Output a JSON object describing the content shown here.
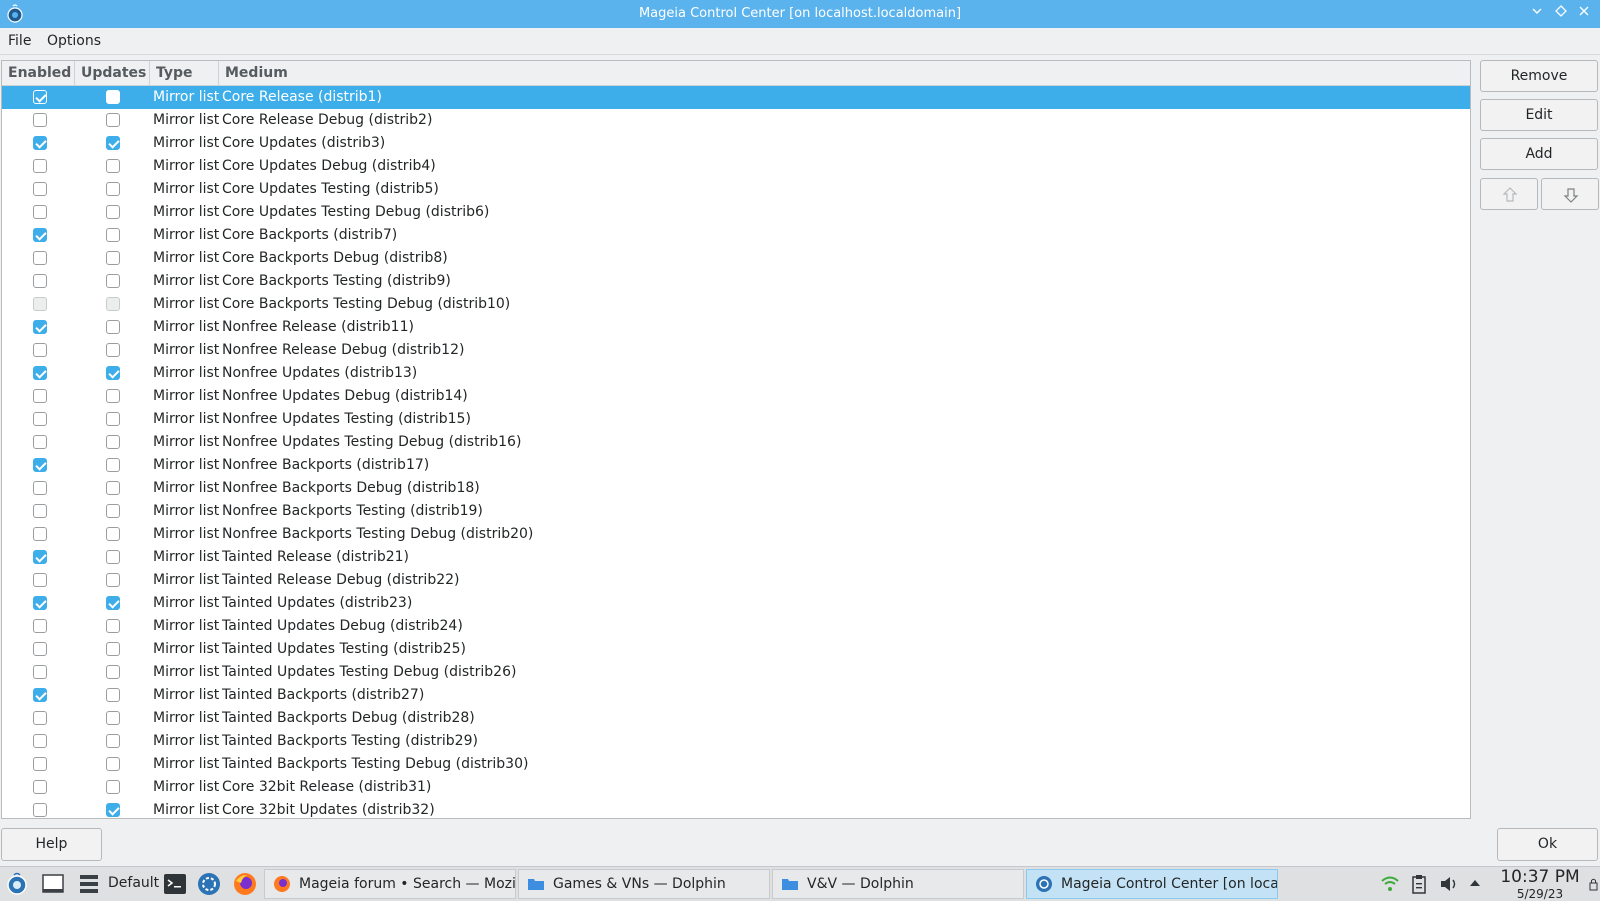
{
  "window": {
    "title": "Mageia Control Center [on localhost.localdomain]",
    "controls": [
      "minimize-icon",
      "maximize-icon",
      "close-icon"
    ]
  },
  "menu": {
    "file": "File",
    "options": "Options"
  },
  "table": {
    "headers": {
      "enabled": "Enabled",
      "updates": "Updates",
      "type": "Type",
      "medium": "Medium"
    },
    "rows": [
      {
        "enabled": true,
        "updates": false,
        "type": "Mirror list",
        "medium": "Core Release (distrib1)",
        "selected": true
      },
      {
        "enabled": false,
        "updates": false,
        "type": "Mirror list",
        "medium": "Core Release Debug (distrib2)"
      },
      {
        "enabled": true,
        "updates": true,
        "type": "Mirror list",
        "medium": "Core Updates (distrib3)"
      },
      {
        "enabled": false,
        "updates": false,
        "type": "Mirror list",
        "medium": "Core Updates Debug (distrib4)"
      },
      {
        "enabled": false,
        "updates": false,
        "type": "Mirror list",
        "medium": "Core Updates Testing (distrib5)"
      },
      {
        "enabled": false,
        "updates": false,
        "type": "Mirror list",
        "medium": "Core Updates Testing Debug (distrib6)"
      },
      {
        "enabled": true,
        "updates": false,
        "type": "Mirror list",
        "medium": "Core Backports (distrib7)"
      },
      {
        "enabled": false,
        "updates": false,
        "type": "Mirror list",
        "medium": "Core Backports Debug (distrib8)"
      },
      {
        "enabled": false,
        "updates": false,
        "type": "Mirror list",
        "medium": "Core Backports Testing (distrib9)"
      },
      {
        "enabled": false,
        "updates": false,
        "type": "Mirror list",
        "medium": "Core Backports Testing Debug (distrib10)",
        "disabled": true
      },
      {
        "enabled": true,
        "updates": false,
        "type": "Mirror list",
        "medium": "Nonfree Release (distrib11)"
      },
      {
        "enabled": false,
        "updates": false,
        "type": "Mirror list",
        "medium": "Nonfree Release Debug (distrib12)"
      },
      {
        "enabled": true,
        "updates": true,
        "type": "Mirror list",
        "medium": "Nonfree Updates (distrib13)"
      },
      {
        "enabled": false,
        "updates": false,
        "type": "Mirror list",
        "medium": "Nonfree Updates Debug (distrib14)"
      },
      {
        "enabled": false,
        "updates": false,
        "type": "Mirror list",
        "medium": "Nonfree Updates Testing (distrib15)"
      },
      {
        "enabled": false,
        "updates": false,
        "type": "Mirror list",
        "medium": "Nonfree Updates Testing Debug (distrib16)"
      },
      {
        "enabled": true,
        "updates": false,
        "type": "Mirror list",
        "medium": "Nonfree Backports (distrib17)"
      },
      {
        "enabled": false,
        "updates": false,
        "type": "Mirror list",
        "medium": "Nonfree Backports Debug (distrib18)"
      },
      {
        "enabled": false,
        "updates": false,
        "type": "Mirror list",
        "medium": "Nonfree Backports Testing (distrib19)"
      },
      {
        "enabled": false,
        "updates": false,
        "type": "Mirror list",
        "medium": "Nonfree Backports Testing Debug (distrib20)"
      },
      {
        "enabled": true,
        "updates": false,
        "type": "Mirror list",
        "medium": "Tainted Release (distrib21)"
      },
      {
        "enabled": false,
        "updates": false,
        "type": "Mirror list",
        "medium": "Tainted Release Debug (distrib22)"
      },
      {
        "enabled": true,
        "updates": true,
        "type": "Mirror list",
        "medium": "Tainted Updates (distrib23)"
      },
      {
        "enabled": false,
        "updates": false,
        "type": "Mirror list",
        "medium": "Tainted Updates Debug (distrib24)"
      },
      {
        "enabled": false,
        "updates": false,
        "type": "Mirror list",
        "medium": "Tainted Updates Testing (distrib25)"
      },
      {
        "enabled": false,
        "updates": false,
        "type": "Mirror list",
        "medium": "Tainted Updates Testing Debug (distrib26)"
      },
      {
        "enabled": true,
        "updates": false,
        "type": "Mirror list",
        "medium": "Tainted Backports (distrib27)"
      },
      {
        "enabled": false,
        "updates": false,
        "type": "Mirror list",
        "medium": "Tainted Backports Debug (distrib28)"
      },
      {
        "enabled": false,
        "updates": false,
        "type": "Mirror list",
        "medium": "Tainted Backports Testing (distrib29)"
      },
      {
        "enabled": false,
        "updates": false,
        "type": "Mirror list",
        "medium": "Tainted Backports Testing Debug (distrib30)"
      },
      {
        "enabled": false,
        "updates": false,
        "type": "Mirror list",
        "medium": "Core 32bit Release (distrib31)"
      },
      {
        "enabled": false,
        "updates": true,
        "type": "Mirror list",
        "medium": "Core 32bit Updates (distrib32)"
      }
    ]
  },
  "side_buttons": {
    "remove": "Remove",
    "edit": "Edit",
    "add": "Add",
    "move_up_icon": "up-arrow-icon",
    "move_down_icon": "down-arrow-icon"
  },
  "bottom_buttons": {
    "help": "Help",
    "ok": "Ok"
  },
  "taskbar": {
    "activity": "Default",
    "tasks": [
      {
        "label": "Mageia forum • Search — Mozilla ...",
        "icon": "firefox-icon"
      },
      {
        "label": "Games & VNs — Dolphin",
        "icon": "folder-icon"
      },
      {
        "label": "V&V — Dolphin",
        "icon": "folder-icon"
      },
      {
        "label": "Mageia Control Center  [on localh...",
        "icon": "mageia-icon",
        "active": true
      }
    ],
    "tray_icons": [
      "wifi-icon",
      "clipboard-icon",
      "volume-icon",
      "expand-tray-icon"
    ],
    "time": "10:37 PM",
    "date": "5/29/23"
  },
  "colors": {
    "titlebar": "#5bb3ee",
    "accent": "#3daee9",
    "window_bg": "#eff0f1"
  }
}
